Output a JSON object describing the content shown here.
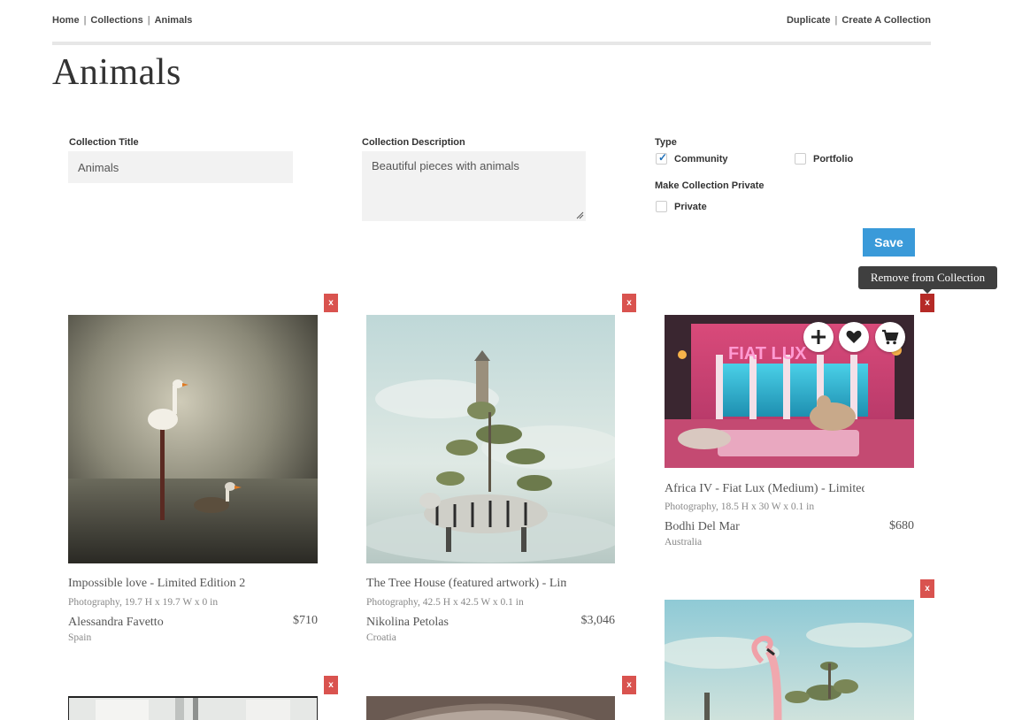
{
  "breadcrumb": {
    "items": [
      "Home",
      "Collections",
      "Animals"
    ],
    "sep": "|"
  },
  "header_actions": {
    "duplicate": "Duplicate",
    "create": "Create A Collection",
    "sep": "|"
  },
  "page": {
    "title": "Animals"
  },
  "form": {
    "title_label": "Collection Title",
    "title_value": "Animals",
    "description_label": "Collection Description",
    "description_value": "Beautiful pieces with animals",
    "type_label": "Type",
    "type_options": [
      {
        "label": "Community",
        "checked": true
      },
      {
        "label": "Portfolio",
        "checked": false
      }
    ],
    "private_label": "Make Collection Private",
    "private_option": {
      "label": "Private",
      "checked": false
    },
    "save_label": "Save"
  },
  "tooltip": {
    "text": "Remove from Collection"
  },
  "remove_label": "x",
  "artworks": [
    {
      "title": "Impossible love - Limited Edition 2",
      "meta": "Photography, 19.7 H x 19.7 W x 0 in",
      "artist": "Alessandra Favetto",
      "price": "$710",
      "country": "Spain"
    },
    {
      "title": "The Tree House (featured artwork) - Limited Edition",
      "meta": "Photography, 42.5 H x 42.5 W x 0.1 in",
      "artist": "Nikolina Petolas",
      "price": "$3,046",
      "country": "Croatia"
    },
    {
      "title": "Africa IV - Fiat Lux (Medium) - Limited Edition",
      "meta": "Photography, 18.5 H x 30 W x 0.1 in",
      "artist": "Bodhi Del Mar",
      "price": "$680",
      "country": "Australia",
      "sign_text": "FIAT LUX"
    }
  ],
  "hover_actions": [
    "plus-icon",
    "heart-icon",
    "cart-icon"
  ],
  "colors": {
    "save": "#3a9ad9",
    "remove": "#d9534f",
    "tooltip": "#3f3f3f",
    "field": "#f2f2f2"
  }
}
